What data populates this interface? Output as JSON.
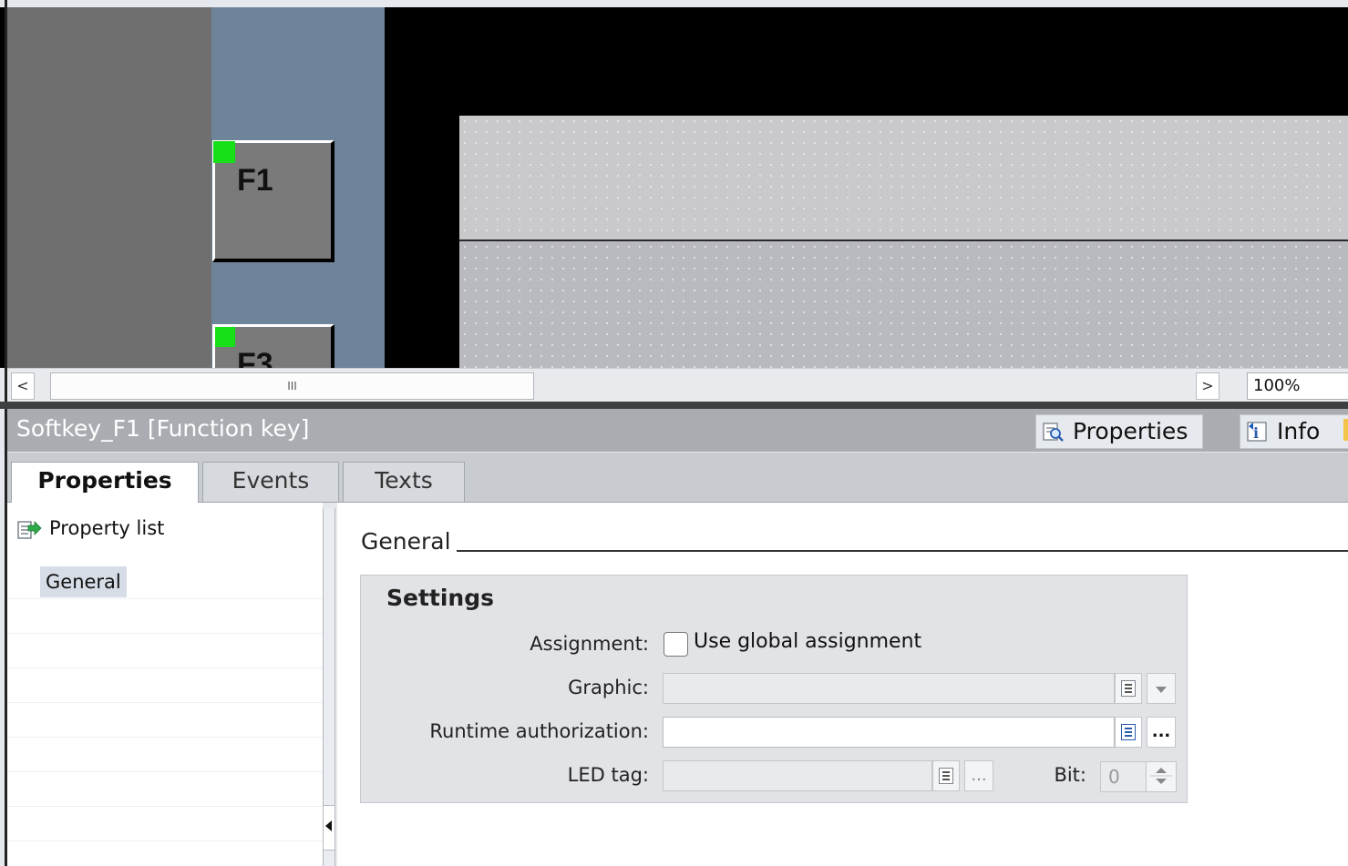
{
  "canvas": {
    "softkeys": [
      {
        "label": "F1"
      },
      {
        "label": "F3"
      }
    ]
  },
  "scrollbar": {
    "left_arrow": "<",
    "thumb_grip": "III",
    "right_arrow": ">",
    "zoom_value": "100%"
  },
  "inspector": {
    "title": "Softkey_F1 [Function key]",
    "top_tabs": [
      {
        "label": "Properties",
        "icon": "properties-icon"
      },
      {
        "label": "Info",
        "icon": "info-icon"
      }
    ],
    "sub_tabs": [
      {
        "label": "Properties",
        "active": true
      },
      {
        "label": "Events",
        "active": false
      },
      {
        "label": "Texts",
        "active": false
      }
    ],
    "nav": {
      "property_list": "Property list",
      "general": "General"
    },
    "section_title": "General",
    "settings": {
      "title": "Settings",
      "assignment_label": "Assignment:",
      "use_global_label": "Use global assignment",
      "use_global_checked": false,
      "graphic_label": "Graphic:",
      "graphic_value": "",
      "runtime_auth_label": "Runtime authorization:",
      "runtime_auth_value": "",
      "led_tag_label": "LED tag:",
      "led_tag_value": "",
      "bit_label": "Bit:",
      "bit_value": "0",
      "browse_label": "..."
    }
  },
  "colors": {
    "led_green": "#18e018",
    "title_bar": "#a9adb2",
    "canvas_blue": "#6e849a"
  }
}
